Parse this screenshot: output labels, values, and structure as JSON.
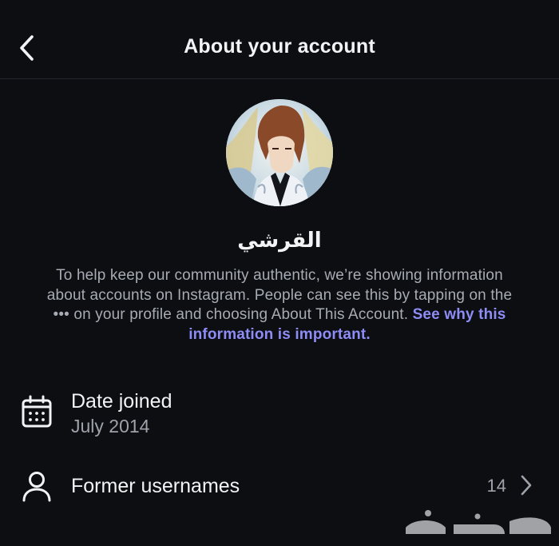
{
  "header": {
    "title": "About your account",
    "back_icon": "chevron-left-icon"
  },
  "profile": {
    "username": "القرشي"
  },
  "description": {
    "text": "To help keep our community authentic, we’re showing information about accounts on Instagram. People can see this by tapping on the ••• on your profile and choosing About This Account. ",
    "link": "See why this information is important."
  },
  "date_joined": {
    "icon": "calendar-icon",
    "label": "Date joined",
    "value": "July 2014"
  },
  "former_usernames": {
    "icon": "person-icon",
    "label": "Former usernames",
    "count": "14",
    "chevron_icon": "chevron-right-icon"
  },
  "watermark": {
    "text": "حراج"
  },
  "colors": {
    "background": "#0c0e12",
    "text_primary": "#f2f3f5",
    "text_secondary": "#a7abb3",
    "link": "#8e8cf5"
  }
}
